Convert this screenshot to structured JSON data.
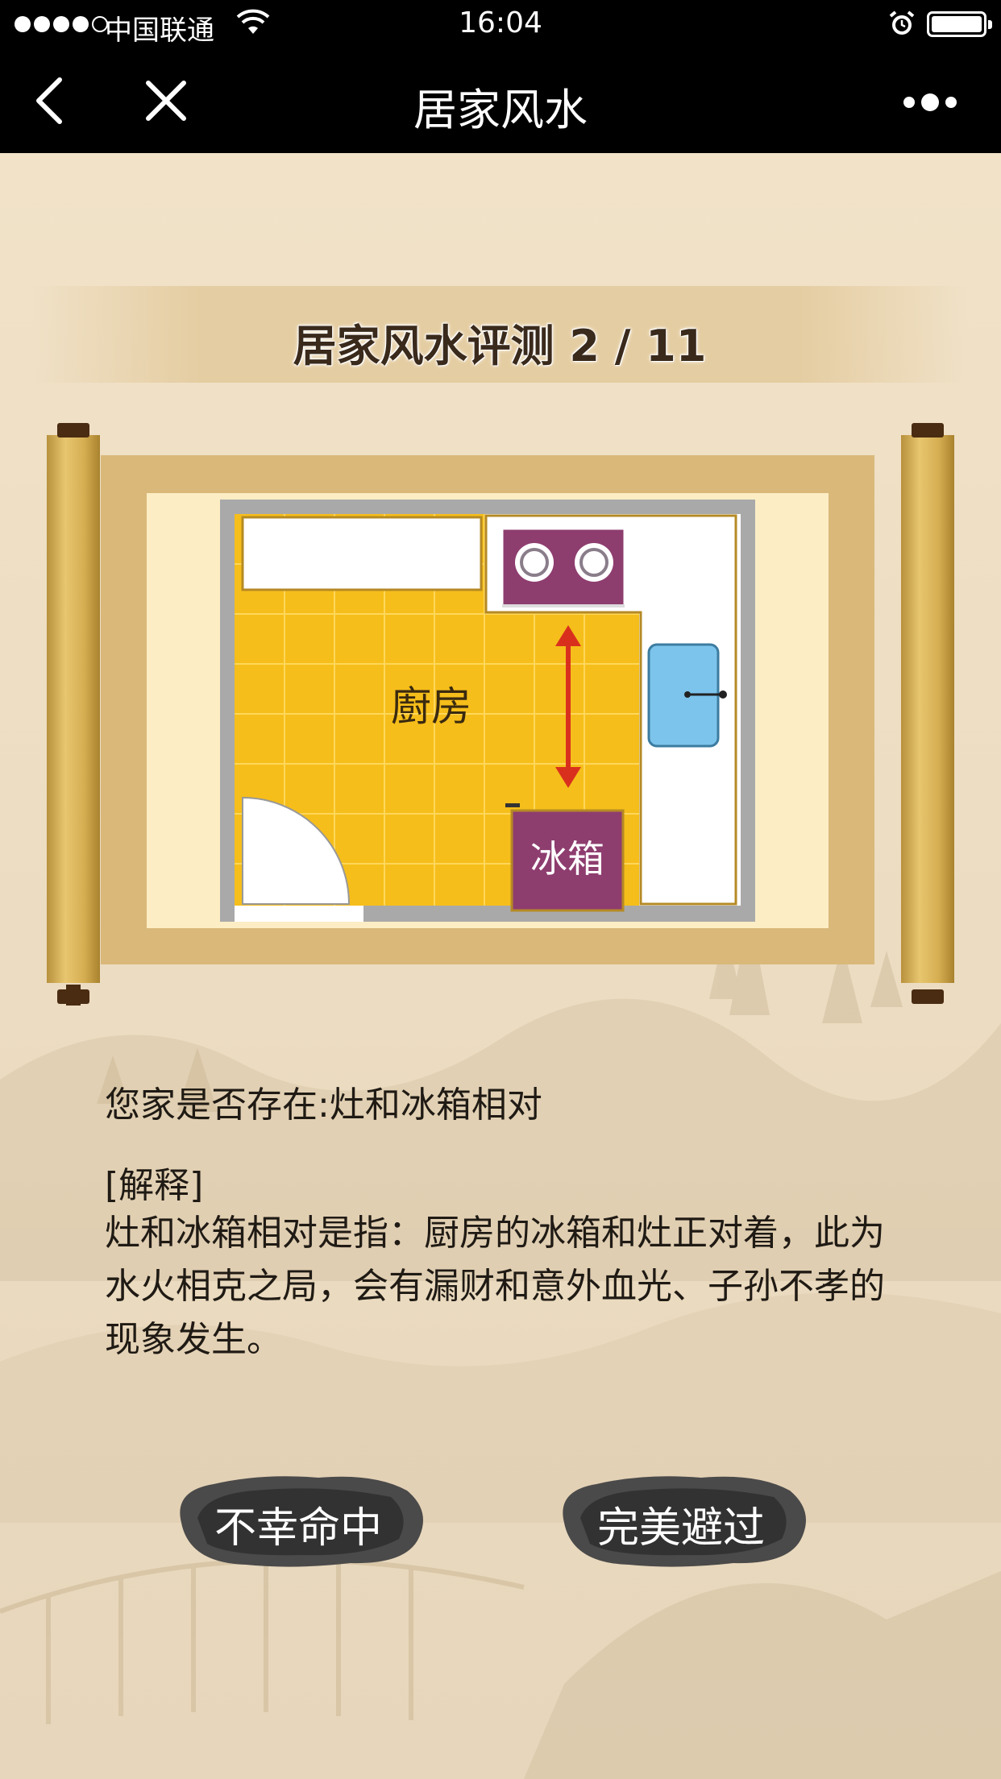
{
  "status_bar": {
    "carrier": "中国联通",
    "time": "16:04",
    "signal_bars": 4,
    "icons": [
      "signal-icon",
      "wifi-icon",
      "alarm-icon",
      "battery-icon"
    ]
  },
  "nav": {
    "title": "居家风水",
    "icons": [
      "back-chevron-icon",
      "close-icon",
      "more-dots-icon"
    ]
  },
  "quiz": {
    "title": "居家风水评测 2 / 11",
    "diagram": {
      "room_label": "廚房",
      "fridge_label": "冰箱"
    },
    "question": "您家是否存在:灶和冰箱相对",
    "explanation_label": "[解释]",
    "explanation_text": "灶和冰箱相对是指：厨房的冰箱和灶正对着，此为水火相克之局，会有漏财和意外血光、子孙不孝的现象发生。"
  },
  "buttons": {
    "hit_label": "不幸命中",
    "avoid_label": "完美避过"
  },
  "colors": {
    "background": "#efe1c9",
    "scroll_frame": "#d9b87a",
    "floor": "#f6be1a",
    "stove": "#8e3d6f",
    "sink": "#7cc4ec",
    "arrow": "#d9301e"
  }
}
